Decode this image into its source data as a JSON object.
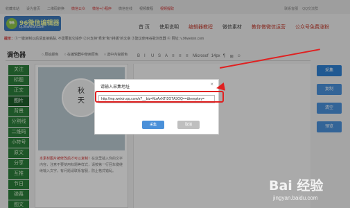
{
  "topbar": {
    "links": [
      "收藏本站",
      "设为首页",
      "二维码转换",
      "微信公众",
      "微信+小程序",
      "微信在线",
      "视频教程",
      "视频提取"
    ],
    "right": [
      "联系客服",
      "QQ交流群"
    ]
  },
  "logo": {
    "mark": "96",
    "name": "96微信编辑器",
    "sub": "bj.96weixin.com"
  },
  "nav": [
    "首 页",
    "使用说明",
    "编辑器教程",
    "微信素材",
    "教你做微信运营",
    "公众号免费涨粉"
  ],
  "notice": {
    "tag": "提示：",
    "text": "①一键复制以后请直接粘贴, 不需要其它操作 ②只支持\"秀米\"和\"i排版\"的文章 ③建议使用谷歌浏览器 ④ 网址: v.96weixin.com"
  },
  "editor": {
    "title": "调色器",
    "options": [
      "原始颜色",
      "在编辑器中使用原色",
      "选中内容颜色"
    ],
    "toolbar": [
      "B",
      "I",
      "U",
      "S",
      "A",
      "≡",
      "≡",
      "≡",
      "Microsof",
      "14px",
      "¶",
      "⊞",
      "☺"
    ]
  },
  "sidebar": [
    "关注",
    "标题",
    "正文",
    "图片",
    "背景",
    "分割线",
    "二维码",
    "小符号",
    "原文",
    "分享",
    "互推",
    "节日",
    "弹幕",
    "图文"
  ],
  "preview": {
    "image_text": [
      "秋",
      "天"
    ],
    "red_text": "本素材图片被修改后才可以复制！",
    "body_text": "在这里插入你的文字内容，注意不要使用标题等样式，请按第一行回车键继续输入文字，有问题请联系客服，防止格式错乱。"
  },
  "side_buttons": [
    "采集",
    "复制",
    "清空",
    "预览"
  ],
  "dialog": {
    "title": "请输入采集地址",
    "close": "×",
    "input_value": "http://mp.weixin.qq.com/s?__biz=MzAxNTI2OTA3OQ==&tempkey=",
    "ok": "采集",
    "cancel": "取消"
  },
  "watermark": {
    "logo": "Bai 经验",
    "url": "jingyan.baidu.com"
  },
  "colors": {
    "accent": "#4a90d9",
    "annotation": "#e02020",
    "sidebar": "#2b7b3a"
  }
}
